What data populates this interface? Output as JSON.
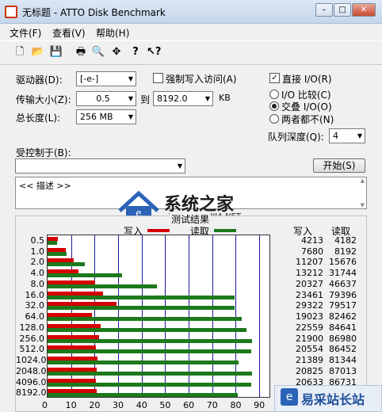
{
  "window": {
    "title": "无标题 - ATTO Disk Benchmark",
    "min": "–",
    "max": "□",
    "close": "✕"
  },
  "menu": [
    "文件(F)",
    "查看(V)",
    "帮助(H)"
  ],
  "settings": {
    "drive_label": "驱动器(D):",
    "drive_value": "[-e-]",
    "force_write_label": "强制写入访问(A)",
    "direct_io_label": "直接 I/O(R)",
    "direct_io_checked": true,
    "transfer_label": "传输大小(Z):",
    "transfer_from": "0.5",
    "to_label": "到",
    "transfer_to": "8192.0",
    "kb_label": "KB",
    "total_label": "总长度(L):",
    "total_value": "256 MB",
    "radio_compare": "I/O 比较(C)",
    "radio_overlap": "交叠 I/O(O)",
    "radio_neither": "两者都不(N)",
    "queue_label": "队列深度(Q):",
    "queue_value": "4",
    "controlled_label": "受控制于(B):",
    "controlled_value": "",
    "start_label": "开始(S)",
    "desc_text": "<< 描述 >>"
  },
  "watermark": {
    "brand": "系统之家",
    "url": "XITONGZHIJIA.NET",
    "corner": "易采站长站"
  },
  "chart": {
    "title": "测试结果",
    "legend_write": "写入",
    "legend_read": "读取",
    "col_write": "写入",
    "col_read": "读取",
    "color_write": "#d40000",
    "color_read": "#1c7a1c"
  },
  "chart_data": {
    "type": "bar",
    "categories": [
      "0.5",
      "1.0",
      "2.0",
      "4.0",
      "8.0",
      "16.0",
      "32.0",
      "64.0",
      "128.0",
      "256.0",
      "512.0",
      "1024.0",
      "2048.0",
      "4096.0",
      "8192.0"
    ],
    "series": [
      {
        "name": "写入",
        "values": [
          4213,
          7680,
          11207,
          13212,
          20327,
          23461,
          29322,
          19023,
          22559,
          21900,
          20554,
          21389,
          20825,
          20633,
          21000
        ]
      },
      {
        "name": "读取",
        "values": [
          4182,
          8192,
          15676,
          31744,
          46637,
          79396,
          79517,
          82462,
          84641,
          86980,
          86452,
          81344,
          87013,
          86731,
          81000
        ]
      }
    ],
    "xlim": [
      0,
      95
    ],
    "xticks": [
      "0",
      "10",
      "20",
      "30",
      "40",
      "50",
      "60",
      "70",
      "80",
      "90"
    ],
    "write_text": [
      "4213",
      "7680",
      "11207",
      "13212",
      "20327",
      "23461",
      "29322",
      "19023",
      "22559",
      "21900",
      "20554",
      "21389",
      "20825",
      "20633",
      ""
    ],
    "read_text": [
      "4182",
      "8192",
      "15676",
      "31744",
      "46637",
      "79396",
      "79517",
      "82462",
      "84641",
      "86980",
      "86452",
      "81344",
      "87013",
      "86731",
      ""
    ]
  }
}
